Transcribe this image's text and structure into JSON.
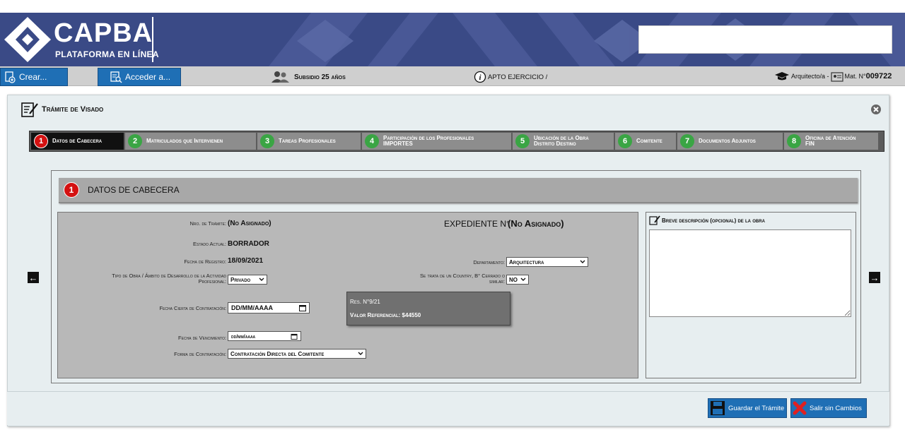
{
  "header": {
    "logo_title": "CAPBA",
    "logo_subtitle": "PLATAFORMA EN LÍNEA",
    "search_value": ""
  },
  "toolbar": {
    "create_label": "Crear...",
    "access_label": "Acceder a...",
    "subsidy_label": "Subsidio 25 años",
    "status_label": "APTO EJERCICIO /",
    "user_role": "Arquitecto/a -",
    "mat_prefix": "Mat. N°",
    "mat_number": "009722"
  },
  "main": {
    "title": "Trámite de Visado"
  },
  "steps": [
    {
      "num": "1",
      "line1": "Datos de Cabecera",
      "line2": ""
    },
    {
      "num": "2",
      "line1": "Matriculados que Intervienen",
      "line2": ""
    },
    {
      "num": "3",
      "line1": "Tareas Profesionales",
      "line2": ""
    },
    {
      "num": "4",
      "line1": "Participación de los Profesionales",
      "line2": "IMPORTES"
    },
    {
      "num": "5",
      "line1": "Ubicación de la Obra",
      "line2": "Distrito Destino"
    },
    {
      "num": "6",
      "line1": "Comitente",
      "line2": ""
    },
    {
      "num": "7",
      "line1": "Documentos Adjuntos",
      "line2": ""
    },
    {
      "num": "8",
      "line1": "Oficina de Atención",
      "line2": "FIN"
    }
  ],
  "section": {
    "num": "1",
    "title": "DATOS DE CABECERA"
  },
  "form": {
    "nro_tramite_label": "Nro. de Trámite:",
    "nro_tramite_value": "(No Asignado)",
    "expediente_label": "EXPEDIENTE N°",
    "expediente_value": "(No Asignado)",
    "estado_label": "Estado Actual:",
    "estado_value": "BORRADOR",
    "fecha_registro_label": "Fecha de Registro:",
    "fecha_registro_value": "18/09/2021",
    "departamento_label": "Departamento:",
    "departamento_value": "Arquitectura",
    "tipo_obra_label_1": "Tipo de Obra / Ámbito de Desarrollo de la Actividad",
    "tipo_obra_label_2": "Profesional:",
    "tipo_obra_value": "Privado",
    "country_label_1": "Se trata de un Country, B° Cerrado o",
    "country_label_2": "similar:",
    "country_value": "NO",
    "fecha_cierta_label": "Fecha Cierta de Contratación:",
    "fecha_cierta_value": "DD/MM/AAAA",
    "fecha_venc_label": "Fecha de Vencimiento:",
    "fecha_venc_value": "dd/mm/aaaa",
    "forma_label": "Forma de Contratación:",
    "forma_value": "Contratación Directa del Comitente"
  },
  "tooltip": {
    "res": "Res. N°9/21",
    "valor": "Valor Referencial: $44550"
  },
  "description": {
    "title": "Breve descripción (opcional) de la obra",
    "value": ""
  },
  "footer": {
    "save_label": "Guardar el Trámite",
    "exit_label": "Salir sin Cambios"
  },
  "colors": {
    "header_bg": "#3a4a86",
    "button_blue": "#1f6fb5",
    "step_active_red": "#d41111",
    "step_green": "#3aa544"
  }
}
